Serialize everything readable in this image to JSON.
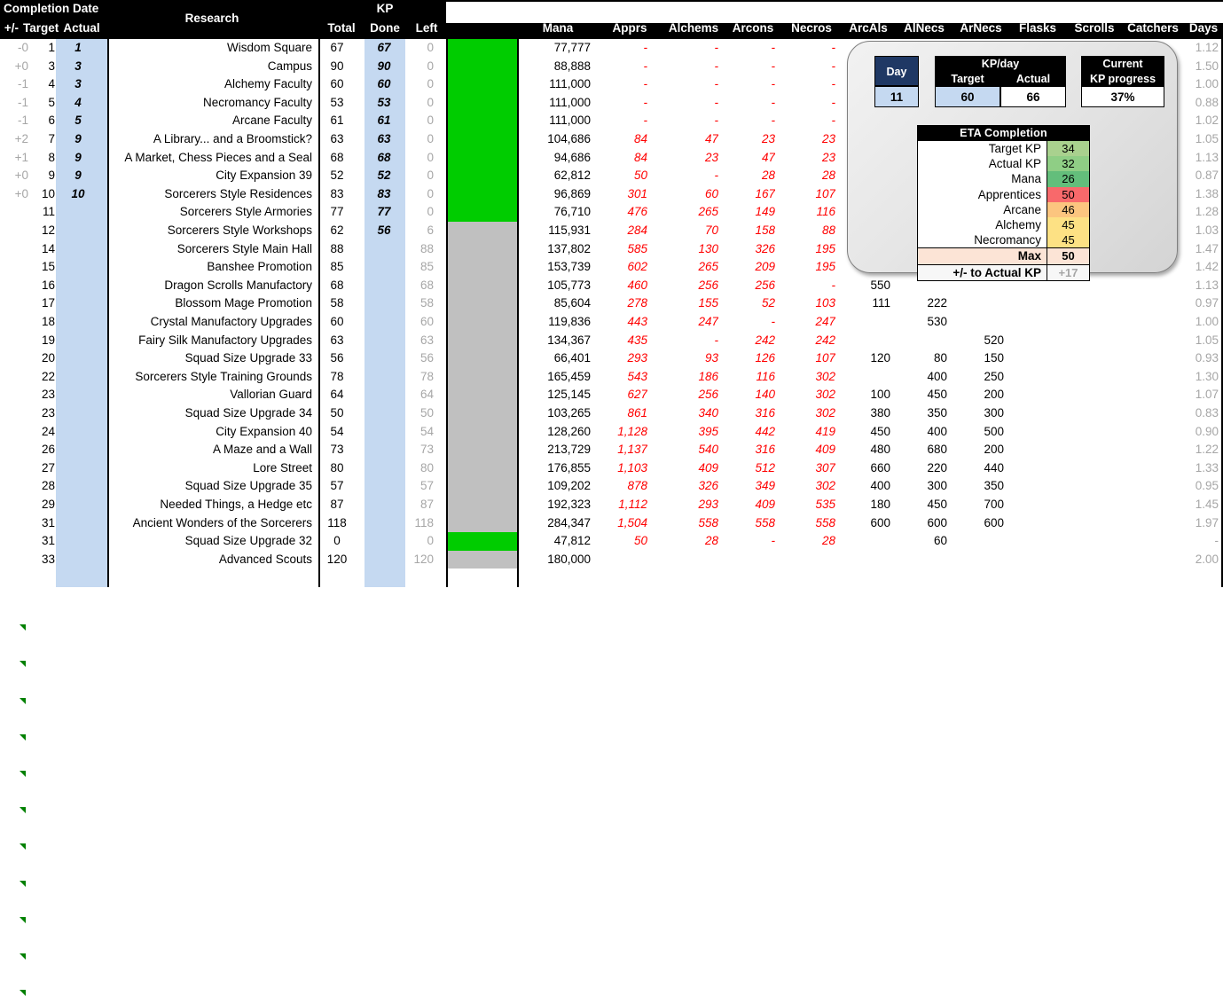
{
  "header": {
    "group_completion_date": "Completion Date",
    "group_kp": "KP",
    "col_plusminus": "+/-",
    "col_target": "Target",
    "col_actual": "Actual",
    "col_research": "Research",
    "col_total": "Total",
    "col_done": "Done",
    "col_left": "Left",
    "col_mana": "Mana",
    "col_apprs": "Apprs",
    "col_alchems": "Alchems",
    "col_arcons": "Arcons",
    "col_necros": "Necros",
    "col_arcals": "ArcAls",
    "col_alnecs": "AlNecs",
    "col_arnecs": "ArNecs",
    "col_flasks": "Flasks",
    "col_scrolls": "Scrolls",
    "col_catchers": "Catchers",
    "col_days": "Days"
  },
  "colors": {
    "header_bg": "#000000",
    "highlight_blue": "#c5d9f1",
    "status_done": "#00cc00",
    "status_pending": "#c0c0c0",
    "negative_red": "#ff0000",
    "dim_gray": "#a6a6a6",
    "panel_navy": "#1f3864"
  },
  "panel": {
    "day_label": "Day",
    "day_value": "11",
    "kpday_title": "KP/day",
    "kpday_target_label": "Target",
    "kpday_actual_label": "Actual",
    "kpday_target_value": "60",
    "kpday_actual_value": "66",
    "progress_title_line1": "Current",
    "progress_title_line2": "KP progress",
    "progress_value": "37%",
    "eta_title": "ETA Completion",
    "eta_rows": [
      {
        "label": "Target KP",
        "value": "34",
        "color": "#a9d18e"
      },
      {
        "label": "Actual KP",
        "value": "32",
        "color": "#8fce85"
      },
      {
        "label": "Mana",
        "value": "26",
        "color": "#63be7b"
      },
      {
        "label": "Apprentices",
        "value": "50",
        "color": "#f8696b"
      },
      {
        "label": "Arcane",
        "value": "46",
        "color": "#fcc57f"
      },
      {
        "label": "Alchemy",
        "value": "45",
        "color": "#fde184"
      },
      {
        "label": "Necromancy",
        "value": "45",
        "color": "#fde184"
      }
    ],
    "eta_max_label": "Max",
    "eta_max_value": "50",
    "eta_max_color": "#fce4d6",
    "eta_delta_label": "+/- to Actual KP",
    "eta_delta_value": "+17",
    "eta_delta_color": "#f7f7f7"
  },
  "rows": [
    {
      "pm": "-0",
      "target": "1",
      "actual": "1",
      "research": "Wisdom Square",
      "total": "67",
      "done": "67",
      "left": "0",
      "status": "done",
      "mana": "77,777",
      "apprs": "-",
      "alchems": "-",
      "arcons": "-",
      "necros": "-",
      "arcals": "",
      "alnecs": "",
      "arnecs": "",
      "flasks": "",
      "scrolls": "",
      "catchers": "",
      "days": "1.12",
      "note": false
    },
    {
      "pm": "+0",
      "target": "3",
      "actual": "3",
      "research": "Campus",
      "total": "90",
      "done": "90",
      "left": "0",
      "status": "done",
      "mana": "88,888",
      "apprs": "-",
      "alchems": "-",
      "arcons": "-",
      "necros": "-",
      "arcals": "",
      "alnecs": "",
      "arnecs": "",
      "flasks": "",
      "scrolls": "",
      "catchers": "",
      "days": "1.50",
      "note": false
    },
    {
      "pm": "-1",
      "target": "4",
      "actual": "3",
      "research": "Alchemy Faculty",
      "total": "60",
      "done": "60",
      "left": "0",
      "status": "done",
      "mana": "111,000",
      "apprs": "-",
      "alchems": "-",
      "arcons": "-",
      "necros": "-",
      "arcals": "",
      "alnecs": "",
      "arnecs": "",
      "flasks": "",
      "scrolls": "",
      "catchers": "",
      "days": "1.00",
      "note": false
    },
    {
      "pm": "-1",
      "target": "5",
      "actual": "4",
      "research": "Necromancy Faculty",
      "total": "53",
      "done": "53",
      "left": "0",
      "status": "done",
      "mana": "111,000",
      "apprs": "-",
      "alchems": "-",
      "arcons": "-",
      "necros": "-",
      "arcals": "",
      "alnecs": "",
      "arnecs": "",
      "flasks": "",
      "scrolls": "",
      "catchers": "",
      "days": "0.88",
      "note": false
    },
    {
      "pm": "-1",
      "target": "6",
      "actual": "5",
      "research": "Arcane Faculty",
      "total": "61",
      "done": "61",
      "left": "0",
      "status": "done",
      "mana": "111,000",
      "apprs": "-",
      "alchems": "-",
      "arcons": "-",
      "necros": "-",
      "arcals": "",
      "alnecs": "",
      "arnecs": "",
      "flasks": "",
      "scrolls": "",
      "catchers": "",
      "days": "1.02",
      "note": false
    },
    {
      "pm": "+2",
      "target": "7",
      "actual": "9",
      "research": "A Library... and a Broomstick?",
      "total": "63",
      "done": "63",
      "left": "0",
      "status": "done",
      "mana": "104,686",
      "apprs": "84",
      "alchems": "47",
      "arcons": "23",
      "necros": "23",
      "arcals": "",
      "alnecs": "",
      "arnecs": "",
      "flasks": "",
      "scrolls": "",
      "catchers": "",
      "days": "1.05",
      "note": false
    },
    {
      "pm": "+1",
      "target": "8",
      "actual": "9",
      "research": "A Market, Chess Pieces and a Seal",
      "total": "68",
      "done": "68",
      "left": "0",
      "status": "done",
      "mana": "94,686",
      "apprs": "84",
      "alchems": "23",
      "arcons": "47",
      "necros": "23",
      "arcals": "",
      "alnecs": "",
      "arnecs": "",
      "flasks": "",
      "scrolls": "",
      "catchers": "",
      "days": "1.13",
      "note": false
    },
    {
      "pm": "+0",
      "target": "9",
      "actual": "9",
      "research": "City Expansion 39",
      "total": "52",
      "done": "52",
      "left": "0",
      "status": "done",
      "mana": "62,812",
      "apprs": "50",
      "alchems": "-",
      "arcons": "28",
      "necros": "28",
      "arcals": "",
      "alnecs": "",
      "arnecs": "",
      "flasks": "",
      "scrolls": "",
      "catchers": "",
      "days": "0.87",
      "note": false
    },
    {
      "pm": "+0",
      "target": "10",
      "actual": "10",
      "research": "Sorcerers Style Residences",
      "total": "83",
      "done": "83",
      "left": "0",
      "status": "done",
      "mana": "96,869",
      "apprs": "301",
      "alchems": "60",
      "arcons": "167",
      "necros": "107",
      "arcals": "",
      "alnecs": "",
      "arnecs": "",
      "flasks": "",
      "scrolls": "",
      "catchers": "",
      "days": "1.38",
      "note": false
    },
    {
      "pm": "",
      "target": "11",
      "actual": "",
      "research": "Sorcerers Style Armories",
      "total": "77",
      "done": "77",
      "left": "0",
      "status": "done",
      "mana": "76,710",
      "apprs": "476",
      "alchems": "265",
      "arcons": "149",
      "necros": "116",
      "arcals": "",
      "alnecs": "",
      "arnecs": "",
      "flasks": "",
      "scrolls": "",
      "catchers": "",
      "days": "1.28",
      "note": false
    },
    {
      "pm": "",
      "target": "12",
      "actual": "",
      "research": "Sorcerers Style Workshops",
      "total": "62",
      "done": "56",
      "left": "6",
      "status": "pending",
      "mana": "115,931",
      "apprs": "284",
      "alchems": "70",
      "arcons": "158",
      "necros": "88",
      "arcals": "",
      "alnecs": "",
      "arnecs": "",
      "flasks": "",
      "scrolls": "",
      "catchers": "",
      "days": "1.03",
      "note": false
    },
    {
      "pm": "",
      "target": "14",
      "actual": "",
      "research": "Sorcerers Style Main Hall",
      "total": "88",
      "done": "",
      "left": "88",
      "status": "pending",
      "mana": "137,802",
      "apprs": "585",
      "alchems": "130",
      "arcons": "326",
      "necros": "195",
      "arcals": "",
      "alnecs": "",
      "arnecs": "",
      "flasks": "",
      "scrolls": "",
      "catchers": "",
      "days": "1.47",
      "note": false
    },
    {
      "pm": "",
      "target": "15",
      "actual": "",
      "research": "Banshee Promotion",
      "total": "85",
      "done": "",
      "left": "85",
      "status": "pending",
      "mana": "153,739",
      "apprs": "602",
      "alchems": "265",
      "arcons": "209",
      "necros": "195",
      "arcals": "",
      "alnecs": "",
      "arnecs": "",
      "flasks": "",
      "scrolls": "",
      "catchers": "",
      "days": "1.42",
      "note": false
    },
    {
      "pm": "",
      "target": "16",
      "actual": "",
      "research": "Dragon Scrolls Manufactory",
      "total": "68",
      "done": "",
      "left": "68",
      "status": "pending",
      "mana": "105,773",
      "apprs": "460",
      "alchems": "256",
      "arcons": "256",
      "necros": "-",
      "arcals": "550",
      "alnecs": "",
      "arnecs": "",
      "flasks": "",
      "scrolls": "",
      "catchers": "",
      "days": "1.13",
      "note": false
    },
    {
      "pm": "",
      "target": "17",
      "actual": "",
      "research": "Blossom Mage Promotion",
      "total": "58",
      "done": "",
      "left": "58",
      "status": "pending",
      "mana": "85,604",
      "apprs": "278",
      "alchems": "155",
      "arcons": "52",
      "necros": "103",
      "arcals": "111",
      "alnecs": "222",
      "arnecs": "",
      "flasks": "",
      "scrolls": "",
      "catchers": "",
      "days": "0.97",
      "note": false
    },
    {
      "pm": "",
      "target": "18",
      "actual": "",
      "research": "Crystal Manufactory Upgrades",
      "total": "60",
      "done": "",
      "left": "60",
      "status": "pending",
      "mana": "119,836",
      "apprs": "443",
      "alchems": "247",
      "arcons": "-",
      "necros": "247",
      "arcals": "",
      "alnecs": "530",
      "arnecs": "",
      "flasks": "",
      "scrolls": "",
      "catchers": "",
      "days": "1.00",
      "note": false
    },
    {
      "pm": "",
      "target": "19",
      "actual": "",
      "research": "Fairy Silk Manufactory Upgrades",
      "total": "63",
      "done": "",
      "left": "63",
      "status": "pending",
      "mana": "134,367",
      "apprs": "435",
      "alchems": "-",
      "arcons": "242",
      "necros": "242",
      "arcals": "",
      "alnecs": "",
      "arnecs": "520",
      "flasks": "",
      "scrolls": "",
      "catchers": "",
      "days": "1.05",
      "note": true
    },
    {
      "pm": "",
      "target": "20",
      "actual": "",
      "research": "Squad Size Upgrade 33",
      "total": "56",
      "done": "",
      "left": "56",
      "status": "pending",
      "mana": "66,401",
      "apprs": "293",
      "alchems": "93",
      "arcons": "126",
      "necros": "107",
      "arcals": "120",
      "alnecs": "80",
      "arnecs": "150",
      "flasks": "",
      "scrolls": "",
      "catchers": "",
      "days": "0.93",
      "note": true
    },
    {
      "pm": "",
      "target": "22",
      "actual": "",
      "research": "Sorcerers Style Training Grounds",
      "total": "78",
      "done": "",
      "left": "78",
      "status": "pending",
      "mana": "165,459",
      "apprs": "543",
      "alchems": "186",
      "arcons": "116",
      "necros": "302",
      "arcals": "",
      "alnecs": "400",
      "arnecs": "250",
      "flasks": "",
      "scrolls": "",
      "catchers": "",
      "days": "1.30",
      "note": true
    },
    {
      "pm": "",
      "target": "23",
      "actual": "",
      "research": "Vallorian Guard",
      "total": "64",
      "done": "",
      "left": "64",
      "status": "pending",
      "mana": "125,145",
      "apprs": "627",
      "alchems": "256",
      "arcons": "140",
      "necros": "302",
      "arcals": "100",
      "alnecs": "450",
      "arnecs": "200",
      "flasks": "",
      "scrolls": "",
      "catchers": "",
      "days": "1.07",
      "note": true
    },
    {
      "pm": "",
      "target": "23",
      "actual": "",
      "research": "Squad Size Upgrade 34",
      "total": "50",
      "done": "",
      "left": "50",
      "status": "pending",
      "mana": "103,265",
      "apprs": "861",
      "alchems": "340",
      "arcons": "316",
      "necros": "302",
      "arcals": "380",
      "alnecs": "350",
      "arnecs": "300",
      "flasks": "",
      "scrolls": "",
      "catchers": "",
      "days": "0.83",
      "note": true
    },
    {
      "pm": "",
      "target": "24",
      "actual": "",
      "research": "City Expansion 40",
      "total": "54",
      "done": "",
      "left": "54",
      "status": "pending",
      "mana": "128,260",
      "apprs": "1,128",
      "alchems": "395",
      "arcons": "442",
      "necros": "419",
      "arcals": "450",
      "alnecs": "400",
      "arnecs": "500",
      "flasks": "",
      "scrolls": "",
      "catchers": "",
      "days": "0.90",
      "note": true
    },
    {
      "pm": "",
      "target": "26",
      "actual": "",
      "research": "A Maze and a Wall",
      "total": "73",
      "done": "",
      "left": "73",
      "status": "pending",
      "mana": "213,729",
      "apprs": "1,137",
      "alchems": "540",
      "arcons": "316",
      "necros": "409",
      "arcals": "480",
      "alnecs": "680",
      "arnecs": "200",
      "flasks": "",
      "scrolls": "",
      "catchers": "",
      "days": "1.22",
      "note": true
    },
    {
      "pm": "",
      "target": "27",
      "actual": "",
      "research": "Lore Street",
      "total": "80",
      "done": "",
      "left": "80",
      "status": "pending",
      "mana": "176,855",
      "apprs": "1,103",
      "alchems": "409",
      "arcons": "512",
      "necros": "307",
      "arcals": "660",
      "alnecs": "220",
      "arnecs": "440",
      "flasks": "",
      "scrolls": "",
      "catchers": "",
      "days": "1.33",
      "note": true
    },
    {
      "pm": "",
      "target": "28",
      "actual": "",
      "research": "Squad Size Upgrade 35",
      "total": "57",
      "done": "",
      "left": "57",
      "status": "pending",
      "mana": "109,202",
      "apprs": "878",
      "alchems": "326",
      "arcons": "349",
      "necros": "302",
      "arcals": "400",
      "alnecs": "300",
      "arnecs": "350",
      "flasks": "",
      "scrolls": "",
      "catchers": "",
      "days": "0.95",
      "note": true
    },
    {
      "pm": "",
      "target": "29",
      "actual": "",
      "research": "Needed Things, a Hedge etc",
      "total": "87",
      "done": "",
      "left": "87",
      "status": "pending",
      "mana": "192,323",
      "apprs": "1,112",
      "alchems": "293",
      "arcons": "409",
      "necros": "535",
      "arcals": "180",
      "alnecs": "450",
      "arnecs": "700",
      "flasks": "",
      "scrolls": "",
      "catchers": "",
      "days": "1.45",
      "note": true
    },
    {
      "pm": "",
      "target": "31",
      "actual": "",
      "research": "Ancient Wonders of the Sorcerers",
      "total": "118",
      "done": "",
      "left": "118",
      "status": "pending",
      "mana": "284,347",
      "apprs": "1,504",
      "alchems": "558",
      "arcons": "558",
      "necros": "558",
      "arcals": "600",
      "alnecs": "600",
      "arnecs": "600",
      "flasks": "",
      "scrolls": "",
      "catchers": "",
      "days": "1.97",
      "note": true
    },
    {
      "pm": "",
      "target": "31",
      "actual": "",
      "research": "Squad Size Upgrade 32",
      "total": "0",
      "done": "",
      "left": "0",
      "status": "done",
      "mana": "47,812",
      "apprs": "50",
      "alchems": "28",
      "arcons": "-",
      "necros": "28",
      "arcals": "",
      "alnecs": "60",
      "arnecs": "",
      "flasks": "",
      "scrolls": "",
      "catchers": "",
      "days": "-",
      "note": false
    },
    {
      "pm": "",
      "target": "33",
      "actual": "",
      "research": "Advanced Scouts",
      "total": "120",
      "done": "",
      "left": "120",
      "status": "pending",
      "mana": "180,000",
      "apprs": "",
      "alchems": "",
      "arcons": "",
      "necros": "",
      "arcals": "",
      "alnecs": "",
      "arnecs": "",
      "flasks": "",
      "scrolls": "",
      "catchers": "",
      "days": "2.00",
      "note": false
    }
  ]
}
